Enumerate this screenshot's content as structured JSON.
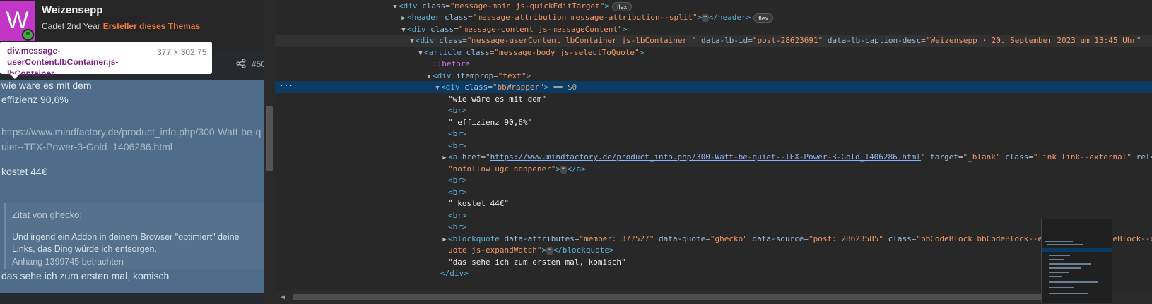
{
  "forum": {
    "avatar_letter": "W",
    "username": "Weizensepp",
    "rank": "Cadet 2nd Year",
    "creator_badge": "Ersteller dieses Themas",
    "post_number": "#50",
    "tooltip": {
      "selector": "div.message-userContent.lbContainer.js-lbContainer",
      "dimensions": "377 × 302.75"
    },
    "post": {
      "line1": "wie wäre es mit dem",
      "line2": "effizienz 90,6%",
      "link": "https://www.mindfactory.de/product_info.php/300-Watt-be-quiet--TFX-Power-3-Gold_1406286.html",
      "price": "kostet 44€",
      "quote": {
        "author": "Zitat von ghecko:",
        "text": "Und irgend ein Addon in deinem Browser \"optimiert\" deine Links, das Ding würde ich entsorgen.",
        "attachment": "Anhang 1399745 betrachten"
      },
      "last_line": "das sehe ich zum ersten mal, komisch"
    }
  },
  "devtools": {
    "flex_badge": "flex",
    "ellipsis": "⋯",
    "gutter_dots": "···",
    "selected_marker": "== $0",
    "l1": {
      "tag": "div",
      "attr": "class",
      "val": "\"message-main js-quickEditTarget\""
    },
    "l2": {
      "tag": "header",
      "attr": "class",
      "val": "\"message-attribution message-attribution--split\"",
      "close": "</header>"
    },
    "l3": {
      "tag": "div",
      "attr": "class",
      "val": "\"message-content js-messageContent\""
    },
    "l4": {
      "tag": "div",
      "attr": "class",
      "val": "\"message-userContent lbContainer js-lbContainer \"",
      "attr2": "data-lb-id",
      "val2": "\"post-28623691\"",
      "attr3": "data-lb-caption-desc",
      "val3": "\"Weizensepp · 20. September 2023 um 13:45 Uhr\""
    },
    "l5": {
      "tag": "article",
      "attr": "class",
      "val": "\"message-body js-selectToQuote\""
    },
    "l6": {
      "pseudo": "::before"
    },
    "l7": {
      "tag": "div",
      "attr": "itemprop",
      "val": "\"text\""
    },
    "l8": {
      "tag": "div",
      "attr": "class",
      "val": "\"bbWrapper\""
    },
    "t1": "\"wie wäre es mit dem\"",
    "br": "<br>",
    "t2": "\" effizienz 90,6%\"",
    "a_line": {
      "tag": "a",
      "attr": "href",
      "href": "https://www.mindfactory.de/product_info.php/300-Watt-be-quiet--TFX-Power-3-Gold_1406286.html",
      "attr2": "target",
      "val2": "\"_blank\"",
      "attr3": "class",
      "val3": "\"link link--external\"",
      "attr4": "rel"
    },
    "a_cont": "\"nofollow ugc noopener\"",
    "a_close": "</a>",
    "t3": "\" kostet 44€\"",
    "bq": {
      "tag": "blockquote",
      "attr": "data-attributes",
      "val": "\"member: 377527\"",
      "attr2": "data-quote",
      "val2": "\"ghecko\"",
      "attr3": "data-source",
      "val3": "\"post: 28623585\"",
      "attr4": "class",
      "val4": "\"bbCodeBlock bbCodeBlock--expandable bbCodeBlock--q"
    },
    "bq_cont": "uote js-expandWatch\"",
    "bq_close": "</blockquote>",
    "t4": "\"das sehe ich zum ersten mal, komisch\"",
    "close_div": "</div>"
  }
}
